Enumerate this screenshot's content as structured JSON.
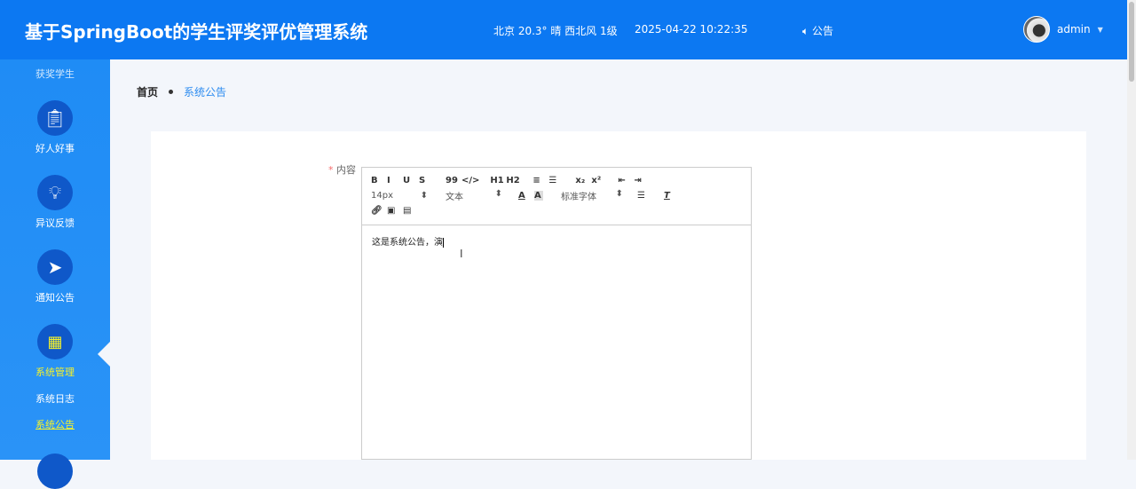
{
  "header": {
    "title": "基于SpringBoot的学生评奖评优管理系统",
    "weather": "北京 20.3° 晴 西北风 1级",
    "datetime": "2025-04-22 10:22:35",
    "notice": "公告",
    "user": "admin"
  },
  "sidebar": {
    "top_partial": "获奖学生",
    "items": [
      {
        "label": "好人好事",
        "icon": "clipboard-icon"
      },
      {
        "label": "异议反馈",
        "icon": "lightbulb-icon"
      },
      {
        "label": "通知公告",
        "icon": "paper-plane-icon"
      },
      {
        "label": "系统管理",
        "icon": "grid-icon"
      }
    ],
    "sub": [
      "系统日志",
      "系统公告"
    ]
  },
  "breadcrumb": {
    "home": "首页",
    "current": "系统公告"
  },
  "form": {
    "label": "内容",
    "required": "*"
  },
  "editor": {
    "row1": [
      "B",
      "I",
      "U",
      "S",
      "99",
      "</>",
      "H1",
      "H2",
      "≡",
      "☰",
      "x₂",
      "x²",
      "⇤",
      "⇥"
    ],
    "size": "14px",
    "header": "文本",
    "font": "标准字体",
    "content": "这是系统公告，演"
  },
  "colors": {
    "header": "#0c78f2",
    "active": "#f6f22a"
  }
}
